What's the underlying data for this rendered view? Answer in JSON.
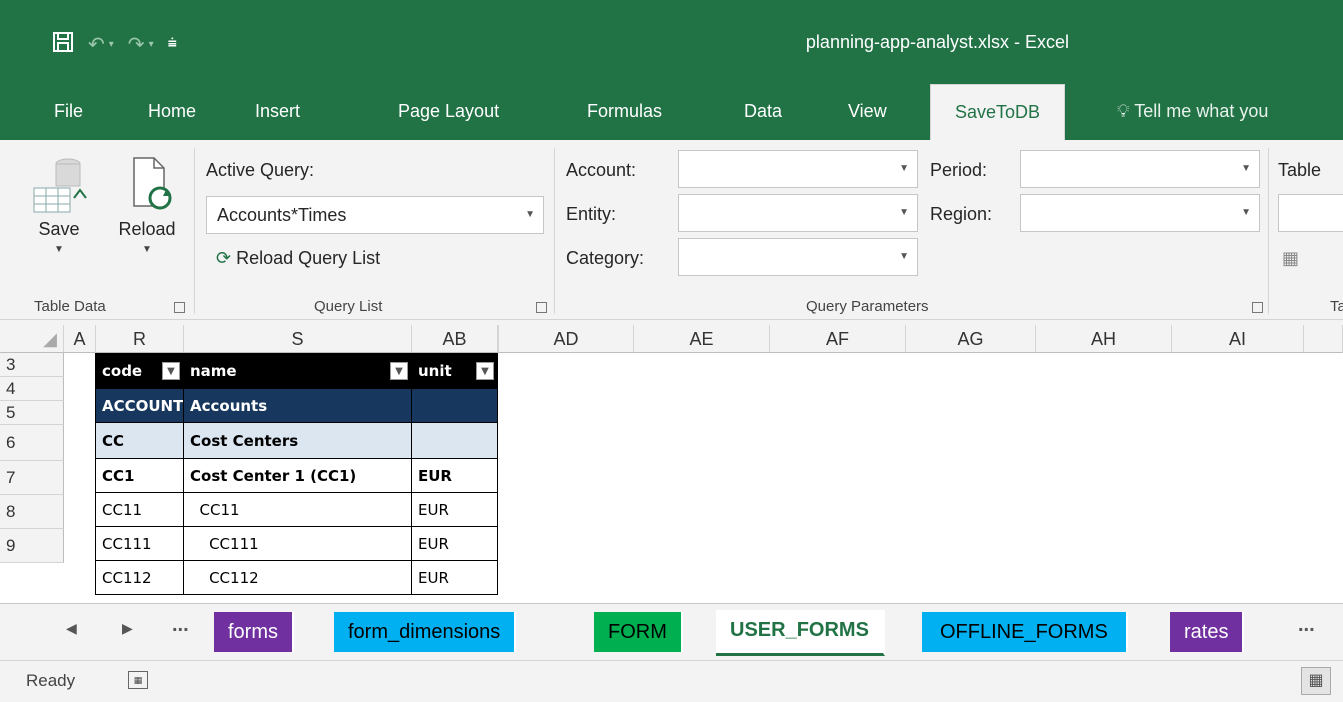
{
  "window": {
    "title": "planning-app-analyst.xlsx  -  Excel"
  },
  "qat": {
    "save_icon": "save-icon",
    "undo_icon": "undo-icon",
    "redo_icon": "redo-icon",
    "customize_icon": "customize-qat-icon"
  },
  "ribbon_tabs": [
    {
      "label": "File"
    },
    {
      "label": "Home"
    },
    {
      "label": "Insert"
    },
    {
      "label": "Page Layout"
    },
    {
      "label": "Formulas"
    },
    {
      "label": "Data"
    },
    {
      "label": "View"
    },
    {
      "label": "SaveToDB"
    },
    {
      "label": "Tell me what you"
    }
  ],
  "ribbon": {
    "table_data": {
      "save_label": "Save",
      "reload_label": "Reload",
      "group_label": "Table Data"
    },
    "query_list": {
      "active_query_label": "Active Query:",
      "active_query_value": "Accounts*Times",
      "reload_query_list_label": "Reload Query List",
      "group_label": "Query List"
    },
    "query_parameters": {
      "account_label": "Account:",
      "entity_label": "Entity:",
      "category_label": "Category:",
      "period_label": "Period:",
      "region_label": "Region:",
      "account_value": "",
      "entity_value": "",
      "category_value": "",
      "period_value": "",
      "region_value": "",
      "group_label": "Query Parameters"
    },
    "table": {
      "label": "Table",
      "group_label": "Ta"
    }
  },
  "grid": {
    "columns": [
      "A",
      "R",
      "S",
      "AB",
      "AD",
      "AE",
      "AF",
      "AG",
      "AH",
      "AI"
    ],
    "rows": [
      "3",
      "4",
      "5",
      "6",
      "7",
      "8",
      "9"
    ],
    "header": {
      "code": "code",
      "name": "name",
      "unit": "unit"
    },
    "data": [
      {
        "code": "ACCOUNTS",
        "name": "Accounts",
        "unit": ""
      },
      {
        "code": "CC",
        "name": "Cost Centers",
        "unit": ""
      },
      {
        "code": "CC1",
        "name": "Cost Center 1 (CC1)",
        "unit": "EUR"
      },
      {
        "code": "CC11",
        "name": "  CC11",
        "unit": "EUR"
      },
      {
        "code": "CC111",
        "name": "    CC111",
        "unit": "EUR"
      },
      {
        "code": "CC112",
        "name": "    CC112",
        "unit": "EUR"
      }
    ]
  },
  "sheet_tabs": {
    "ellipsis_left": "...",
    "ellipsis_right": "...",
    "tabs": [
      {
        "label": "forms",
        "color": "#7030a0"
      },
      {
        "label": "form_dimensions",
        "color": "#00b0f0"
      },
      {
        "label": "FORM",
        "color": "#00b050"
      },
      {
        "label": "USER_FORMS",
        "color": "#ffffff"
      },
      {
        "label": "OFFLINE_FORMS",
        "color": "#00b0f0"
      },
      {
        "label": "rates",
        "color": "#7030a0"
      }
    ]
  },
  "status": {
    "ready": "Ready"
  },
  "colors": {
    "excel_green": "#217346",
    "header_black": "#000000",
    "navy": "#17375e",
    "light_blue": "#dce6f1"
  }
}
